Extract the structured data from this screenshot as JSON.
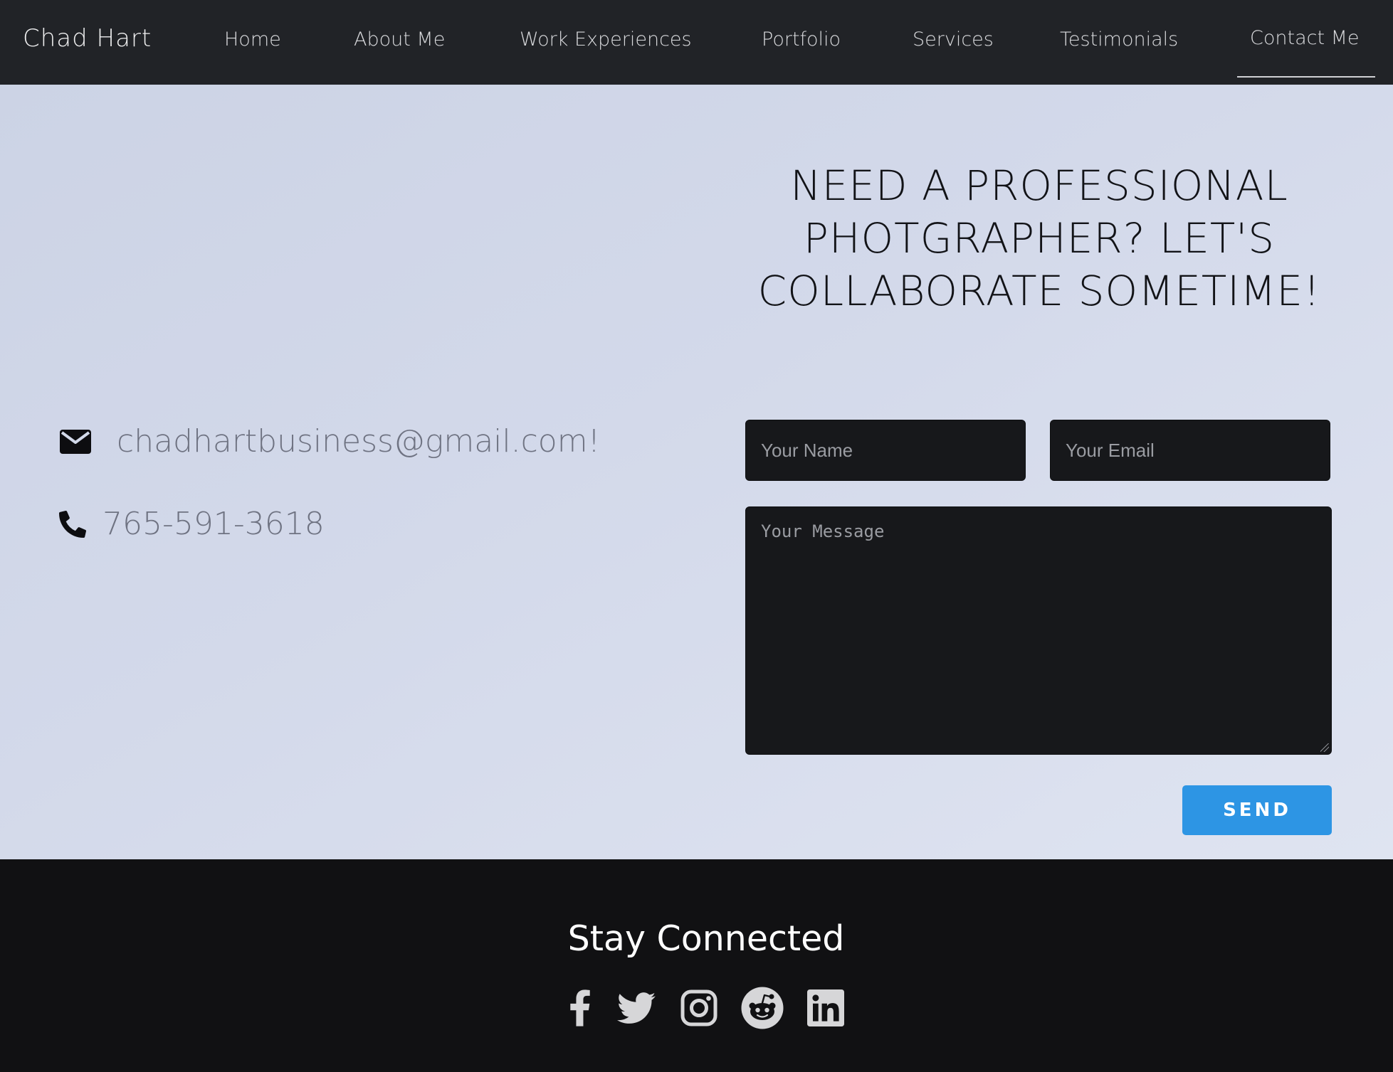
{
  "nav": {
    "brand": "Chad Hart",
    "items": [
      {
        "label": "Home"
      },
      {
        "label": "About Me"
      },
      {
        "label": "Work Experiences"
      },
      {
        "label": "Portfolio"
      },
      {
        "label": "Services"
      },
      {
        "label": "Testimonials"
      },
      {
        "label": "Contact Me",
        "active": true
      }
    ]
  },
  "contact": {
    "headline": "NEED A PROFESSIONAL PHOTGRAPHER? LET'S COLLABORATE SOMETIME!",
    "email": "chadhartbusiness@gmail.com!",
    "phone": "765-591-3618",
    "email_icon": "envelope-icon",
    "phone_icon": "phone-icon"
  },
  "form": {
    "name_placeholder": "Your Name",
    "email_placeholder": "Your Email",
    "message_placeholder": "Your Message",
    "send_label": "SEND"
  },
  "footer": {
    "title": "Stay Connected",
    "social_icons": [
      "facebook-icon",
      "twitter-icon",
      "instagram-icon",
      "reddit-icon",
      "linkedin-icon"
    ]
  },
  "colors": {
    "nav_bg": "#212327",
    "footer_bg": "#111113",
    "field_bg": "#17181b",
    "send_button": "#2d95e4"
  }
}
